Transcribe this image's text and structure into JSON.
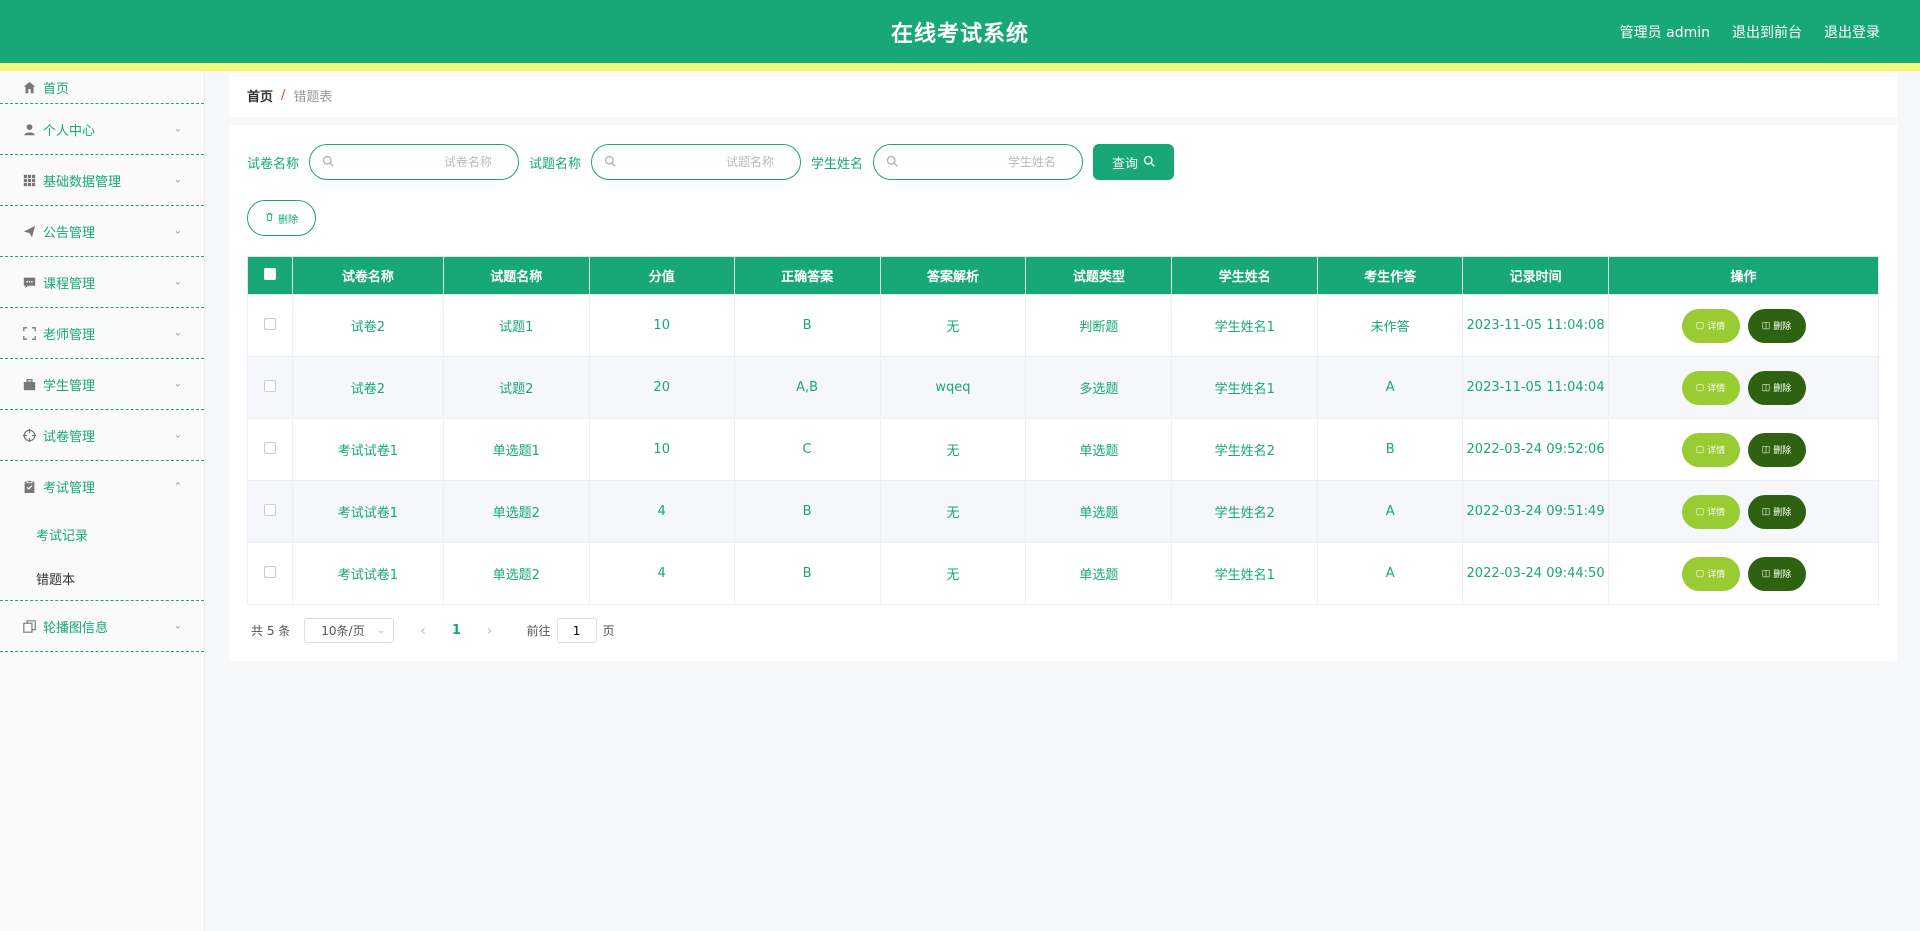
{
  "header": {
    "title": "在线考试系统",
    "admin_label": "管理员 admin",
    "frontend_label": "退出到前台",
    "logout_label": "退出登录"
  },
  "sidebar": {
    "items": [
      {
        "label": "首页",
        "icon": "home-icon"
      },
      {
        "label": "个人中心",
        "icon": "user-icon"
      },
      {
        "label": "基础数据管理",
        "icon": "grid-icon"
      },
      {
        "label": "公告管理",
        "icon": "send-icon"
      },
      {
        "label": "课程管理",
        "icon": "message-icon"
      },
      {
        "label": "老师管理",
        "icon": "fullscreen-icon"
      },
      {
        "label": "学生管理",
        "icon": "briefcase-icon"
      },
      {
        "label": "试卷管理",
        "icon": "target-icon"
      },
      {
        "label": "考试管理",
        "icon": "clipboard-icon"
      },
      {
        "label": "轮播图信息",
        "icon": "copy-icon"
      }
    ],
    "submenu": [
      {
        "label": "考试记录"
      },
      {
        "label": "错题本"
      }
    ]
  },
  "breadcrumb": {
    "home": "首页",
    "separator": "/",
    "current": "错题表"
  },
  "search": {
    "paper_label": "试卷名称",
    "paper_placeholder": "试卷名称",
    "question_label": "试题名称",
    "question_placeholder": "试题名称",
    "student_label": "学生姓名",
    "student_placeholder": "学生姓名",
    "query_label": "查询"
  },
  "toolbar": {
    "delete_label": "删除"
  },
  "table": {
    "headers": [
      "试卷名称",
      "试题名称",
      "分值",
      "正确答案",
      "答案解析",
      "试题类型",
      "学生姓名",
      "考生作答",
      "记录时间",
      "操作"
    ],
    "rows": [
      {
        "paper": "试卷2",
        "question": "试题1",
        "score": "10",
        "answer": "B",
        "analysis": "无",
        "type": "判断题",
        "student": "学生姓名1",
        "response": "未作答",
        "time": "2023-11-05 11:04:08"
      },
      {
        "paper": "试卷2",
        "question": "试题2",
        "score": "20",
        "answer": "A,B",
        "analysis": "wqeq",
        "type": "多选题",
        "student": "学生姓名1",
        "response": "A",
        "time": "2023-11-05 11:04:04"
      },
      {
        "paper": "考试试卷1",
        "question": "单选题1",
        "score": "10",
        "answer": "C",
        "analysis": "无",
        "type": "单选题",
        "student": "学生姓名2",
        "response": "B",
        "time": "2022-03-24 09:52:06"
      },
      {
        "paper": "考试试卷1",
        "question": "单选题2",
        "score": "4",
        "answer": "B",
        "analysis": "无",
        "type": "单选题",
        "student": "学生姓名2",
        "response": "A",
        "time": "2022-03-24 09:51:49"
      },
      {
        "paper": "考试试卷1",
        "question": "单选题2",
        "score": "4",
        "answer": "B",
        "analysis": "无",
        "type": "单选题",
        "student": "学生姓名1",
        "response": "A",
        "time": "2022-03-24 09:44:50"
      }
    ],
    "detail_label": "详情",
    "delete_label": "删除"
  },
  "pagination": {
    "total": "共 5 条",
    "page_size": "10条/页",
    "current_page": "1",
    "goto_label": "前往",
    "goto_value": "1",
    "page_suffix": "页"
  },
  "colors": {
    "primary": "#18a878",
    "strip": "#f5f97a",
    "detail_button": "#99cc33",
    "delete_button": "#2e6210"
  }
}
